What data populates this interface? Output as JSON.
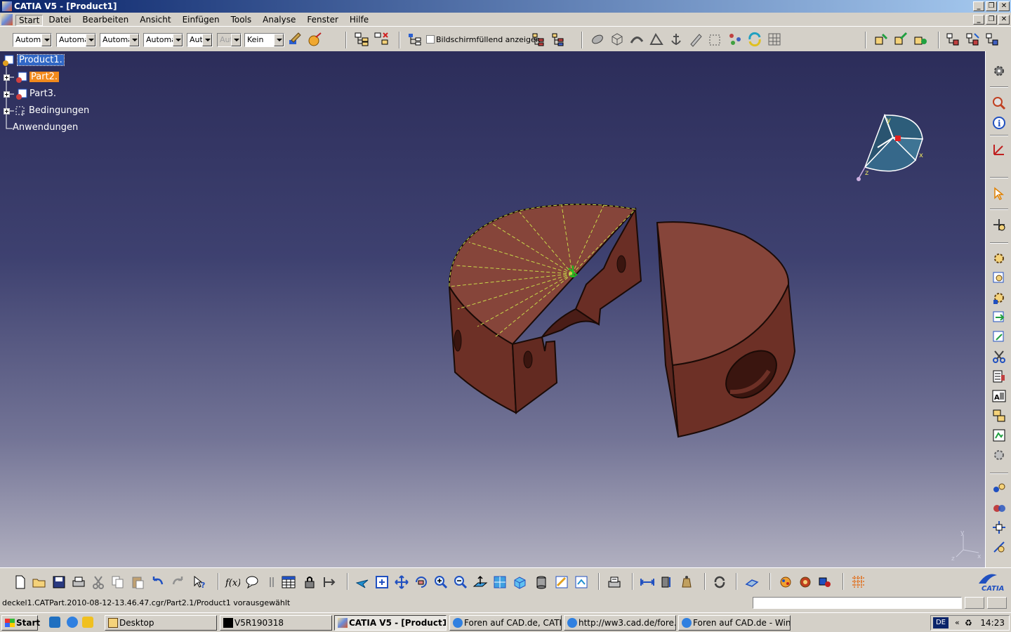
{
  "window": {
    "title": "CATIA V5 - [Product1]"
  },
  "menu": [
    "Start",
    "Datei",
    "Bearbeiten",
    "Ansicht",
    "Einfügen",
    "Tools",
    "Analyse",
    "Fenster",
    "Hilfe"
  ],
  "toolbar": {
    "combos": [
      "Automa",
      "Automa",
      "Automa",
      "Automa",
      "Aut",
      "Aut",
      "Kein"
    ],
    "fullscreen_label": "Bildschirmfüllend anzeigen"
  },
  "tree": {
    "root": "Product1.",
    "part2": "Part2.",
    "part3": "Part3.",
    "constraints": "Bedingungen",
    "applications": "Anwendungen"
  },
  "compass": {
    "x": "x",
    "y": "y",
    "z": "z"
  },
  "axis": {
    "x": "x",
    "y": "y",
    "z": "z"
  },
  "brand": "CATIA",
  "status": {
    "message": "deckel1.CATPart.2010-08-12-13.46.47.cgr/Part2.1/Product1 vorausgewählt"
  },
  "taskbar": {
    "start": "Start",
    "tasks": [
      "Desktop",
      "V5R190318",
      "CATIA V5 - [Product1]",
      "Foren auf CAD.de, CATI...",
      "http://ww3.cad.de/fore...",
      "Foren auf CAD.de - Win..."
    ],
    "lang": "DE",
    "clock": "14:23"
  },
  "colors": {
    "model": "#7a3a2e",
    "model_top": "#86453a",
    "selection": "#3168c6",
    "highlight": "#f18a1d",
    "viewport_top": "#2c2d5a",
    "viewport_bottom": "#b1b0c0"
  }
}
